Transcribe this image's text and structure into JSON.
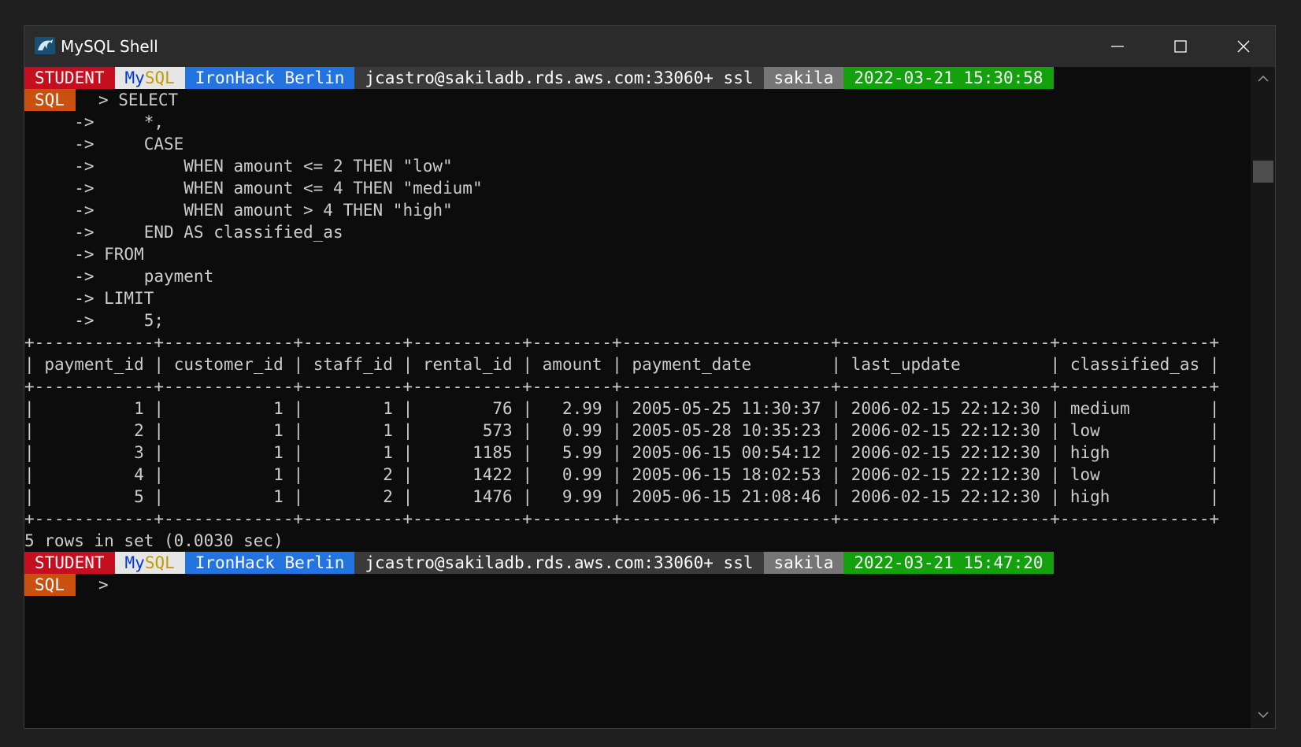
{
  "window": {
    "title": "MySQL Shell",
    "icon": "mysql-dolphin-icon",
    "controls": [
      "minimize-icon",
      "maximize-icon",
      "close-icon"
    ]
  },
  "prompt_bar_1": {
    "user": "STUDENT",
    "engine_my": "My",
    "engine_sql": "SQL",
    "connection_name": "IronHack Berlin",
    "host": "jcastro@sakiladb.rds.aws.com:33060+ ssl",
    "schema": "sakila",
    "timestamp": "2022-03-21 15:30:58"
  },
  "query": {
    "mode": "SQL",
    "lines": [
      "> SELECT",
      "->     *,",
      "->     CASE",
      "->         WHEN amount <= 2 THEN \"low\"",
      "->         WHEN amount <= 4 THEN \"medium\"",
      "->         WHEN amount > 4 THEN \"high\"",
      "->     END AS classified_as",
      "-> FROM",
      "->     payment",
      "-> LIMIT",
      "->     5;"
    ]
  },
  "result_table": {
    "columns": [
      "payment_id",
      "customer_id",
      "staff_id",
      "rental_id",
      "amount",
      "payment_date",
      "last_update",
      "classified_as"
    ],
    "rows": [
      [
        "1",
        "1",
        "1",
        "76",
        "2.99",
        "2005-05-25 11:30:37",
        "2006-02-15 22:12:30",
        "medium"
      ],
      [
        "2",
        "1",
        "1",
        "573",
        "0.99",
        "2005-05-28 10:35:23",
        "2006-02-15 22:12:30",
        "low"
      ],
      [
        "3",
        "1",
        "1",
        "1185",
        "5.99",
        "2005-06-15 00:54:12",
        "2006-02-15 22:12:30",
        "high"
      ],
      [
        "4",
        "1",
        "2",
        "1422",
        "0.99",
        "2005-06-15 18:02:53",
        "2006-02-15 22:12:30",
        "low"
      ],
      [
        "5",
        "1",
        "2",
        "1476",
        "9.99",
        "2005-06-15 21:08:46",
        "2006-02-15 22:12:30",
        "high"
      ]
    ],
    "summary": "5 rows in set (0.0030 sec)"
  },
  "prompt_bar_2": {
    "user": "STUDENT",
    "engine_my": "My",
    "engine_sql": "SQL",
    "connection_name": "IronHack Berlin",
    "host": "jcastro@sakiladb.rds.aws.com:33060+ ssl",
    "schema": "sakila",
    "timestamp": "2022-03-21 15:47:20"
  },
  "current_prompt": {
    "mode": "SQL",
    "symbol": ">"
  },
  "colors": {
    "student": "#c50f1f",
    "connection": "#2374e1",
    "schema": "#767676",
    "timestamp": "#13a10e",
    "mode": "#ca5010",
    "terminal_bg": "#0c0c0c"
  }
}
